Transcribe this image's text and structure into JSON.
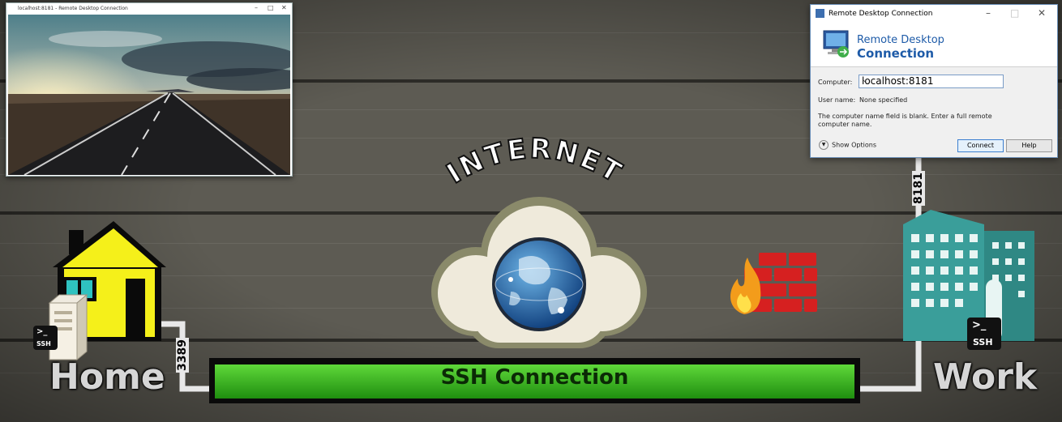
{
  "diagram": {
    "internet_label": "INTERNET",
    "home_label": "Home",
    "work_label": "Work",
    "ssh_connection_label": "SSH Connection",
    "home_port": "3389",
    "work_port": "8181",
    "ssh_badge_prompt": ">_",
    "ssh_badge_text": "SSH"
  },
  "remote_window": {
    "title": "localhost:8181 - Remote Desktop Connection"
  },
  "rdc_dialog": {
    "title": "Remote Desktop Connection",
    "banner_line1": "Remote Desktop",
    "banner_line2": "Connection",
    "computer_label": "Computer:",
    "computer_value": "localhost:8181",
    "username_label": "User name:",
    "username_value": "None specified",
    "message": "The computer name field is blank. Enter a full remote computer name.",
    "show_options_label": "Show Options",
    "connect_label": "Connect",
    "help_label": "Help"
  },
  "icons": [
    "house-icon",
    "server-icon",
    "cloud-icon",
    "globe-icon",
    "firewall-icon",
    "fire-icon",
    "office-building-icon",
    "terminal-ssh-icon",
    "rdc-app-icon",
    "minimize-icon",
    "maximize-icon",
    "close-icon",
    "chevron-down-icon"
  ],
  "colors": {
    "house_yellow": "#f5f01a",
    "building_teal": "#3a9e9a",
    "ssh_green": "#3cc423",
    "firewall_red": "#d62020",
    "rdc_blue": "#1e5ba8"
  }
}
